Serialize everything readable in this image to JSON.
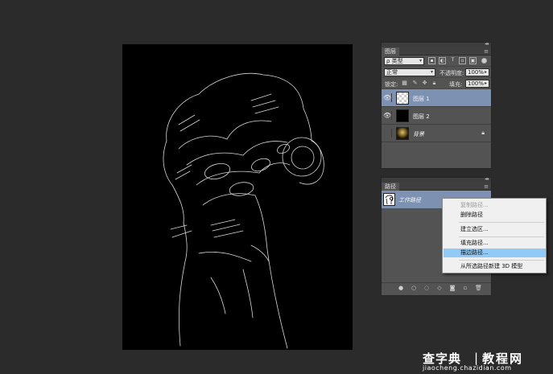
{
  "layers_panel": {
    "tab_label": "图层",
    "filter_type": "ρ 类型",
    "blend_mode": "正常",
    "opacity_label": "不透明度:",
    "opacity_value": "100%",
    "lock_label": "锁定:",
    "fill_label": "填充:",
    "fill_value": "100%",
    "layers": [
      {
        "name": "图层 1",
        "visible": true,
        "selected": true
      },
      {
        "name": "图层 2",
        "visible": true,
        "selected": false
      },
      {
        "name": "背景",
        "visible": false,
        "selected": false,
        "locked": true
      }
    ]
  },
  "paths_panel": {
    "tab_label": "路径",
    "path_name": "工作路径"
  },
  "context_menu": {
    "items": [
      {
        "label": "复制路径...",
        "enabled": false
      },
      {
        "label": "删除路径",
        "enabled": true
      },
      {
        "label": "建立选区...",
        "enabled": true
      },
      {
        "label": "填充路径...",
        "enabled": true
      },
      {
        "label": "描边路径...",
        "enabled": true,
        "highlighted": true
      },
      {
        "label": "从所选路径新建 3D 模型",
        "enabled": true
      }
    ]
  },
  "watermark": {
    "logo": "查字典",
    "subtitle": "教程网",
    "url": "jiaocheng.chazidian.com"
  },
  "colors": {
    "workspace": "#2b2b2b",
    "panel": "#535353",
    "selection": "#7d91b3",
    "menu_highlight": "#91c9f7"
  },
  "icons": [
    "eye-icon",
    "lock-icon",
    "panel-menu-icon",
    "fill-path-icon",
    "stroke-path-icon",
    "load-selection-icon",
    "make-work-path-icon",
    "add-mask-icon",
    "new-path-icon",
    "delete-icon"
  ]
}
